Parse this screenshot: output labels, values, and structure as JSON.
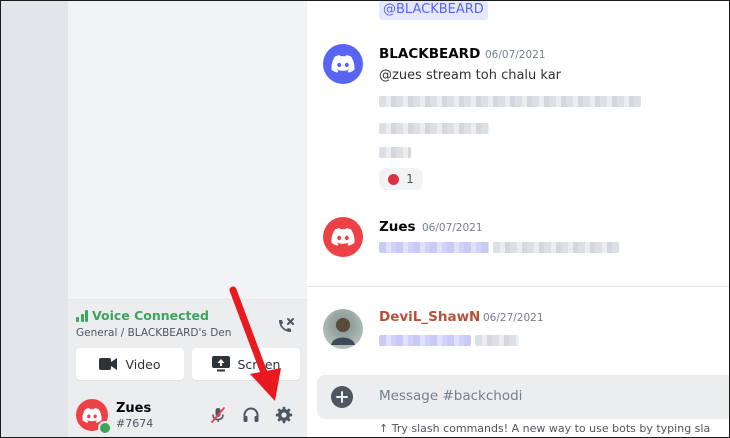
{
  "voice": {
    "status": "Voice Connected",
    "channel": "General / BLACKBEARD's Den",
    "video_label": "Video",
    "screen_label": "Screen"
  },
  "user": {
    "name": "Zues",
    "discriminator": "#7674"
  },
  "chat": {
    "top_mention": "@BLACKBEARD",
    "messages": [
      {
        "author": "BLACKBEARD",
        "time": "06/07/2021",
        "text": "@zues stream toh chalu kar",
        "avatar_color": "#5865f2"
      },
      {
        "author": "Zues",
        "time": "06/07/2021",
        "avatar_color": "#ed4245"
      },
      {
        "author": "DeviL_ShawN",
        "time": "06/27/2021",
        "author_color": "#b9503a"
      }
    ],
    "reaction": {
      "count": "1"
    },
    "input_placeholder": "Message #backchodi",
    "hint": "Try slash commands! A new way to use bots by typing sla"
  },
  "colors": {
    "voice_green": "#3ba55d",
    "blurple": "#5865f2",
    "red": "#ed4245",
    "annotation_arrow": "#e8191f"
  }
}
